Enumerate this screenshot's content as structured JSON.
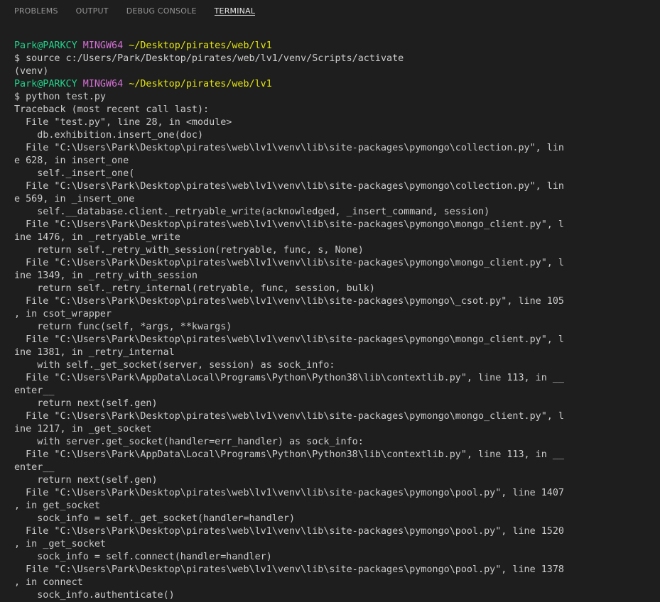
{
  "tabs": [
    {
      "label": "PROBLEMS",
      "active": false
    },
    {
      "label": "OUTPUT",
      "active": false
    },
    {
      "label": "DEBUG CONSOLE",
      "active": false
    },
    {
      "label": "TERMINAL",
      "active": true
    }
  ],
  "prompt": {
    "user": "Park@PARKCY",
    "host": "MINGW64",
    "path": "~/Desktop/pirates/web/lv1"
  },
  "terminal": {
    "lines": [
      {
        "type": "prompt"
      },
      {
        "type": "text",
        "text": "$ source c:/Users/Park/Desktop/pirates/web/lv1/venv/Scripts/activate"
      },
      {
        "type": "text",
        "text": "(venv)"
      },
      {
        "type": "prompt"
      },
      {
        "type": "text",
        "text": "$ python test.py"
      },
      {
        "type": "text",
        "text": "Traceback (most recent call last):"
      },
      {
        "type": "text",
        "text": "  File \"test.py\", line 28, in <module>"
      },
      {
        "type": "text",
        "text": "    db.exhibition.insert_one(doc)"
      },
      {
        "type": "text",
        "text": "  File \"C:\\Users\\Park\\Desktop\\pirates\\web\\lv1\\venv\\lib\\site-packages\\pymongo\\collection.py\", lin"
      },
      {
        "type": "text",
        "text": "e 628, in insert_one"
      },
      {
        "type": "text",
        "text": "    self._insert_one("
      },
      {
        "type": "text",
        "text": "  File \"C:\\Users\\Park\\Desktop\\pirates\\web\\lv1\\venv\\lib\\site-packages\\pymongo\\collection.py\", lin"
      },
      {
        "type": "text",
        "text": "e 569, in _insert_one"
      },
      {
        "type": "text",
        "text": "    self.__database.client._retryable_write(acknowledged, _insert_command, session)"
      },
      {
        "type": "text",
        "text": "  File \"C:\\Users\\Park\\Desktop\\pirates\\web\\lv1\\venv\\lib\\site-packages\\pymongo\\mongo_client.py\", l"
      },
      {
        "type": "text",
        "text": "ine 1476, in _retryable_write"
      },
      {
        "type": "text",
        "text": "    return self._retry_with_session(retryable, func, s, None)"
      },
      {
        "type": "text",
        "text": "  File \"C:\\Users\\Park\\Desktop\\pirates\\web\\lv1\\venv\\lib\\site-packages\\pymongo\\mongo_client.py\", l"
      },
      {
        "type": "text",
        "text": "ine 1349, in _retry_with_session"
      },
      {
        "type": "text",
        "text": "    return self._retry_internal(retryable, func, session, bulk)"
      },
      {
        "type": "text",
        "text": "  File \"C:\\Users\\Park\\Desktop\\pirates\\web\\lv1\\venv\\lib\\site-packages\\pymongo\\_csot.py\", line 105"
      },
      {
        "type": "text",
        "text": ", in csot_wrapper"
      },
      {
        "type": "text",
        "text": "    return func(self, *args, **kwargs)"
      },
      {
        "type": "text",
        "text": "  File \"C:\\Users\\Park\\Desktop\\pirates\\web\\lv1\\venv\\lib\\site-packages\\pymongo\\mongo_client.py\", l"
      },
      {
        "type": "text",
        "text": "ine 1381, in _retry_internal"
      },
      {
        "type": "text",
        "text": "    with self._get_socket(server, session) as sock_info:"
      },
      {
        "type": "text",
        "text": "  File \"C:\\Users\\Park\\AppData\\Local\\Programs\\Python\\Python38\\lib\\contextlib.py\", line 113, in __"
      },
      {
        "type": "text",
        "text": "enter__"
      },
      {
        "type": "text",
        "text": "    return next(self.gen)"
      },
      {
        "type": "text",
        "text": "  File \"C:\\Users\\Park\\Desktop\\pirates\\web\\lv1\\venv\\lib\\site-packages\\pymongo\\mongo_client.py\", l"
      },
      {
        "type": "text",
        "text": "ine 1217, in _get_socket"
      },
      {
        "type": "text",
        "text": "    with server.get_socket(handler=err_handler) as sock_info:"
      },
      {
        "type": "text",
        "text": "  File \"C:\\Users\\Park\\AppData\\Local\\Programs\\Python\\Python38\\lib\\contextlib.py\", line 113, in __"
      },
      {
        "type": "text",
        "text": "enter__"
      },
      {
        "type": "text",
        "text": "    return next(self.gen)"
      },
      {
        "type": "text",
        "text": "  File \"C:\\Users\\Park\\Desktop\\pirates\\web\\lv1\\venv\\lib\\site-packages\\pymongo\\pool.py\", line 1407"
      },
      {
        "type": "text",
        "text": ", in get_socket"
      },
      {
        "type": "text",
        "text": "    sock_info = self._get_socket(handler=handler)"
      },
      {
        "type": "text",
        "text": "  File \"C:\\Users\\Park\\Desktop\\pirates\\web\\lv1\\venv\\lib\\site-packages\\pymongo\\pool.py\", line 1520"
      },
      {
        "type": "text",
        "text": ", in _get_socket"
      },
      {
        "type": "text",
        "text": "    sock_info = self.connect(handler=handler)"
      },
      {
        "type": "text",
        "text": "  File \"C:\\Users\\Park\\Desktop\\pirates\\web\\lv1\\venv\\lib\\site-packages\\pymongo\\pool.py\", line 1378"
      },
      {
        "type": "text",
        "text": ", in connect"
      },
      {
        "type": "text",
        "text": "    sock_info.authenticate()"
      }
    ]
  }
}
